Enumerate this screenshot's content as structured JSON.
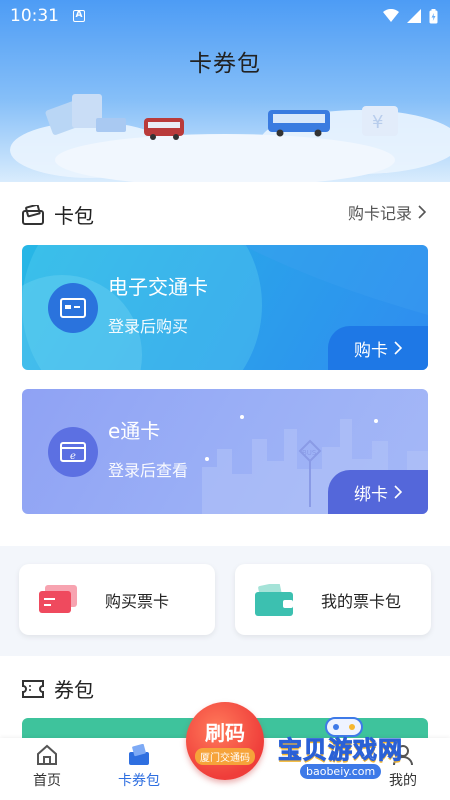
{
  "status_bar": {
    "time": "10:31",
    "notification_letter": "A"
  },
  "header": {
    "title": "卡券包"
  },
  "card_wallet": {
    "title": "卡包",
    "link": "购卡记录",
    "cards": [
      {
        "name": "电子交通卡",
        "subtitle": "登录后购买",
        "action": "购卡"
      },
      {
        "name": "e通卡",
        "subtitle": "登录后查看",
        "action": "绑卡",
        "bus_sign": "BUS"
      }
    ]
  },
  "quick_actions": [
    {
      "label": "购买票卡"
    },
    {
      "label": "我的票卡包"
    }
  ],
  "coupon_wallet": {
    "title": "券包"
  },
  "fab": {
    "main": "刷码",
    "tag": "厦门交通码"
  },
  "tabbar": {
    "items": [
      {
        "label": "首页"
      },
      {
        "label": "卡券包"
      },
      {
        "label": "我的"
      }
    ]
  },
  "watermark": {
    "text": "宝贝游戏网",
    "url": "baobeiy.com"
  },
  "colors": {
    "accent": "#2f8cf0",
    "card2": "#9aaff6",
    "fab": "#ef3d3a"
  }
}
